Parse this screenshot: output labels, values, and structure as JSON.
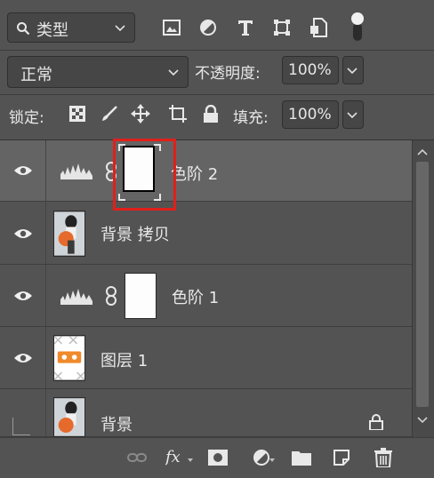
{
  "filter": {
    "icon": "search-icon",
    "label": "类型"
  },
  "blend": {
    "mode": "正常",
    "opacity_label": "不透明度:",
    "opacity_value": "100%"
  },
  "lock": {
    "label": "锁定:",
    "fill_label": "填充:",
    "fill_value": "100%"
  },
  "layers": [
    {
      "type": "adjustment-levels",
      "name": "色阶 2",
      "visible": true,
      "selected": true,
      "highlighted_mask": true
    },
    {
      "type": "pixel",
      "name": "背景 拷贝",
      "visible": true
    },
    {
      "type": "adjustment-levels",
      "name": "色阶 1",
      "visible": true
    },
    {
      "type": "pixel",
      "name": "图层 1",
      "visible": true
    },
    {
      "type": "background",
      "name": "背景",
      "visible": false,
      "locked": true
    }
  ],
  "colors": {
    "panel_bg": "#535353",
    "selected_row": "#646464",
    "highlight": "#e0201b"
  }
}
